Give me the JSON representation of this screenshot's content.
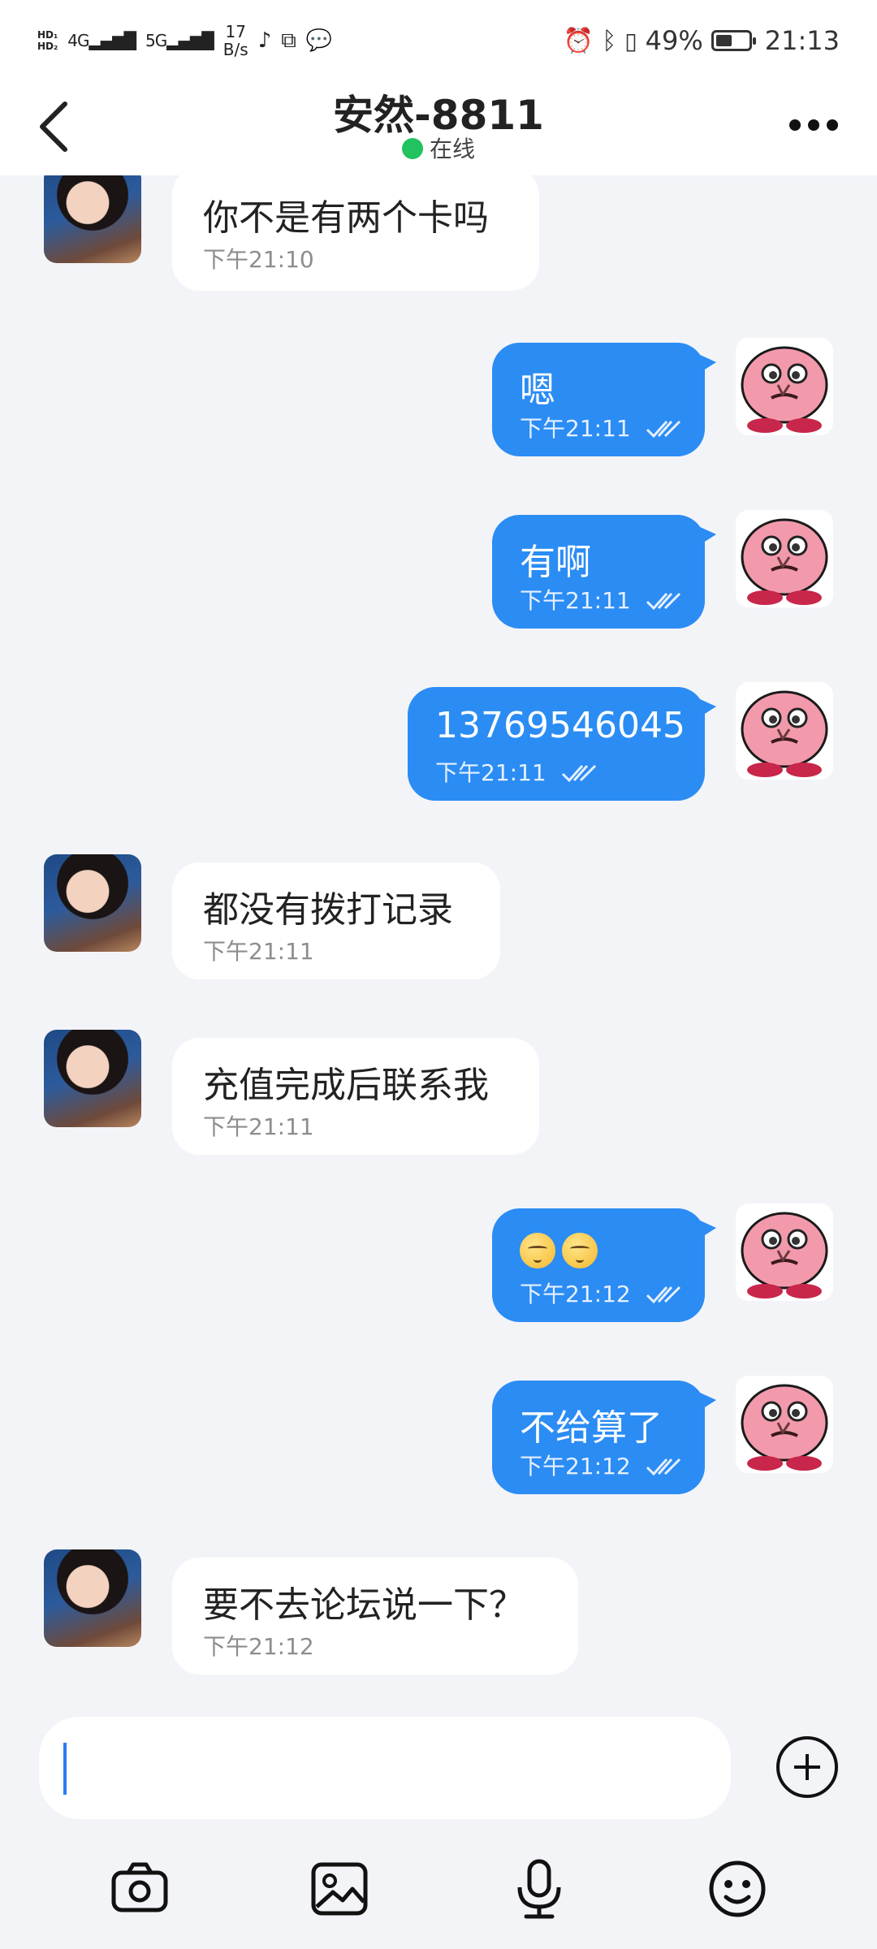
{
  "status_bar": {
    "hd1": "HD₁",
    "hd2": "HD₂",
    "net1": "4G",
    "net2": "5G",
    "speed_value": "17",
    "speed_unit": "B/s",
    "battery_percent": "49%",
    "battery_level": 0.49,
    "time": "21:13"
  },
  "header": {
    "title": "安然-8811",
    "status": "在线"
  },
  "messages": [
    {
      "side": "in",
      "text": "你不是有两个卡吗",
      "time": "下午21:10"
    },
    {
      "side": "out",
      "text": "嗯",
      "time": "下午21:11"
    },
    {
      "side": "out",
      "text": "有啊",
      "time": "下午21:11"
    },
    {
      "side": "out",
      "text": "13769546045",
      "time": "下午21:11"
    },
    {
      "side": "in",
      "text": "都没有拨打记录",
      "time": "下午21:11"
    },
    {
      "side": "in",
      "text": "充值完成后联系我",
      "time": "下午21:11"
    },
    {
      "side": "out",
      "text": "",
      "time": "下午21:12",
      "emoji": [
        "sleepy-face",
        "sleepy-face"
      ]
    },
    {
      "side": "out",
      "text": "不给算了",
      "time": "下午21:12"
    },
    {
      "side": "in",
      "text": "要不去论坛说一下？",
      "time": "下午21:12"
    }
  ],
  "input": {
    "value": "",
    "placeholder": ""
  },
  "toolbar": {
    "icons": [
      "camera-icon",
      "image-icon",
      "microphone-icon",
      "emoji-icon",
      "plus-icon"
    ]
  },
  "colors": {
    "accent": "#2b8cf4",
    "online": "#22c35e",
    "background": "#f3f4f8"
  }
}
